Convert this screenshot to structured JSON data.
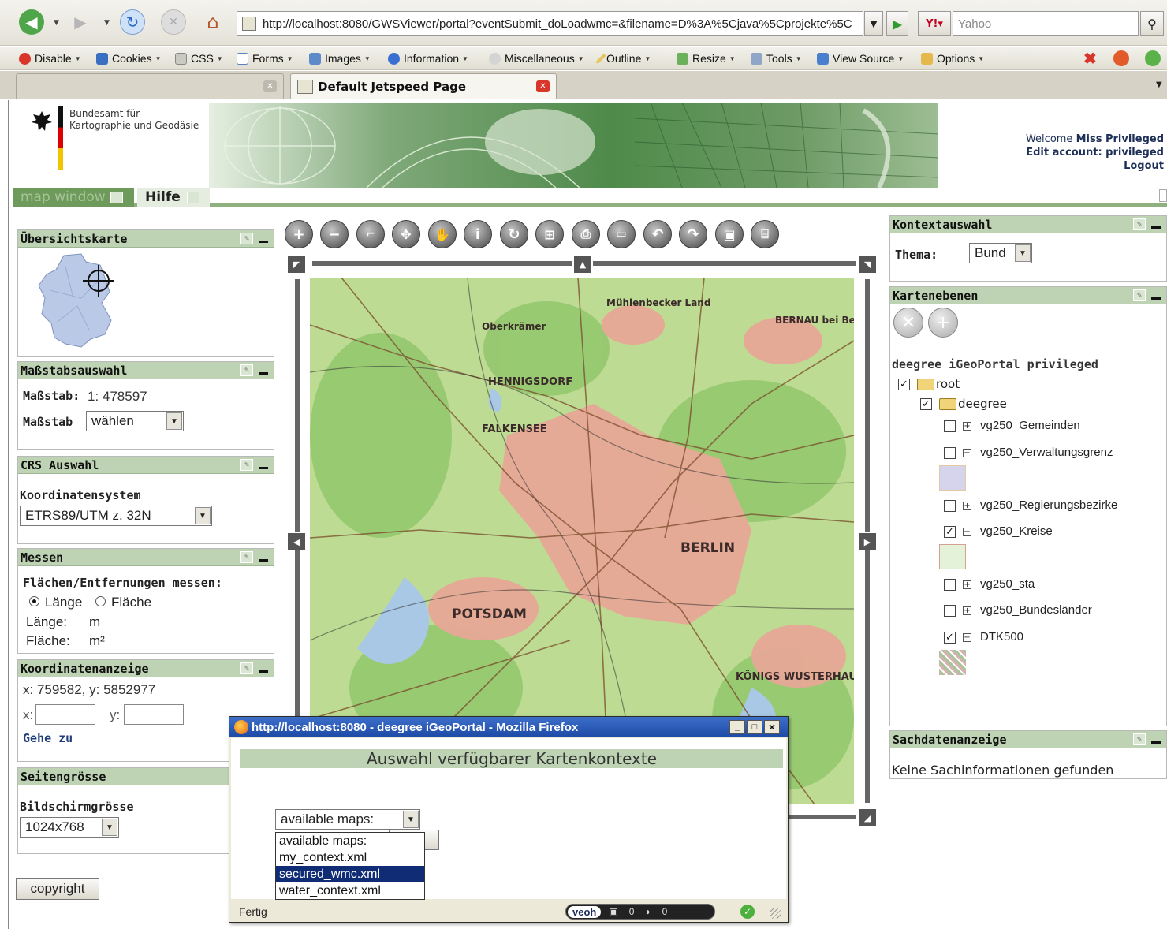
{
  "browser": {
    "url": "http://localhost:8080/GWSViewer/portal?eventSubmit_doLoadwmc=&filename=D%3A%5Cjava%5Cprojekte%5C",
    "search_placeholder": "Yahoo",
    "webdev_toolbar": [
      "Disable",
      "Cookies",
      "CSS",
      "Forms",
      "Images",
      "Information",
      "Miscellaneous",
      "Outline",
      "Resize",
      "Tools",
      "View Source",
      "Options"
    ],
    "active_tab": "Default Jetspeed Page"
  },
  "header": {
    "logo_line1": "Bundesamt für",
    "logo_line2": "Kartographie und Geodäsie",
    "welcome_prefix": "Welcome",
    "welcome_user": "Miss Privileged",
    "edit_account": "Edit account: privileged",
    "logout": "Logout"
  },
  "menu": {
    "map_window": "map window",
    "hilfe": "Hilfe"
  },
  "left": {
    "overview_title": "Übersichtskarte",
    "scale_title": "Maßstabsauswahl",
    "scale_label": "Maßstab:",
    "scale_value": "1: 478597",
    "scale_select_label": "Maßstab",
    "scale_select_value": "wählen",
    "crs_title": "CRS Auswahl",
    "crs_label": "Koordinatensystem",
    "crs_value": "ETRS89/UTM z. 32N",
    "measure_title": "Messen",
    "measure_label": "Flächen/Entfernungen messen:",
    "radio_length": "Länge",
    "radio_area": "Fläche",
    "length_label": "Länge:",
    "length_unit": "m",
    "area_label": "Fläche:",
    "area_unit": "m²",
    "coord_title": "Koordinatenanzeige",
    "coord_value": "x: 759582, y: 5852977",
    "x_label": "x:",
    "y_label": "y:",
    "goto": "Gehe zu",
    "pagesize_title": "Seitengrösse",
    "screen_label": "Bildschirmgrösse",
    "screen_value": "1024x768",
    "copyright": "copyright"
  },
  "map_labels": [
    "BERLIN",
    "POTSDAM",
    "HENNIGSDORF",
    "FALKENSEE",
    "BERNAU bei Berlin",
    "KÖNIGS WUSTERHAUSEN",
    "Oberkrämer",
    "Mühlenbecker Land"
  ],
  "right": {
    "context_title": "Kontextauswahl",
    "thema_label": "Thema:",
    "thema_value": "Bund",
    "layers_title": "Kartenebenen",
    "tree_title": "deegree iGeoPortal privileged",
    "tree": {
      "root": "root",
      "group": "deegree",
      "layers": [
        {
          "name": "vg250_Gemeinden",
          "checked": false,
          "expander": "+"
        },
        {
          "name": "vg250_Verwaltungsgrenz",
          "checked": false,
          "expander": "−"
        },
        {
          "name": "vg250_Regierungsbezirke",
          "checked": false,
          "expander": "+"
        },
        {
          "name": "vg250_Kreise",
          "checked": true,
          "expander": "−"
        },
        {
          "name": "vg250_sta",
          "checked": false,
          "expander": "+"
        },
        {
          "name": "vg250_Bundesländer",
          "checked": false,
          "expander": "+"
        },
        {
          "name": "DTK500",
          "checked": true,
          "expander": "−"
        }
      ]
    },
    "info_title": "Sachdatenanzeige",
    "info_text": "Keine Sachinformationen gefunden"
  },
  "popup": {
    "title": "http://localhost:8080 - deegree iGeoPortal - Mozilla Firefox",
    "heading": "Auswahl verfügbarer Kartenkontexte",
    "select_value": "available maps:",
    "options": [
      "available maps:",
      "my_context.xml",
      "secured_wmc.xml",
      "water_context.xml"
    ],
    "selected_option": "secured_wmc.xml",
    "status": "Fertig",
    "veoh": "veoh",
    "veoh_count1": "0",
    "veoh_count2": "0"
  },
  "colors": {
    "portlet_header": "#bed3b4",
    "accent_green": "#8fb07f",
    "popup_titlebar": "#1c4aa6",
    "dropdown_selected": "#102c74"
  }
}
